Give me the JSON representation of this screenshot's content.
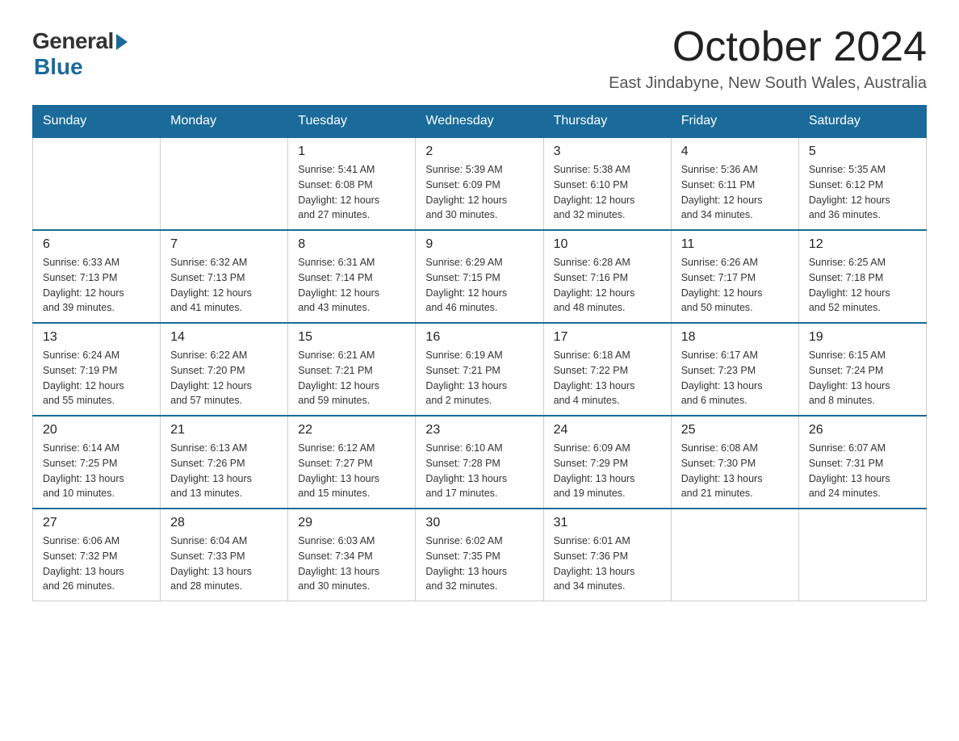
{
  "logo": {
    "general": "General",
    "blue": "Blue"
  },
  "title": "October 2024",
  "location": "East Jindabyne, New South Wales, Australia",
  "headers": [
    "Sunday",
    "Monday",
    "Tuesday",
    "Wednesday",
    "Thursday",
    "Friday",
    "Saturday"
  ],
  "weeks": [
    [
      {
        "day": "",
        "info": ""
      },
      {
        "day": "",
        "info": ""
      },
      {
        "day": "1",
        "info": "Sunrise: 5:41 AM\nSunset: 6:08 PM\nDaylight: 12 hours\nand 27 minutes."
      },
      {
        "day": "2",
        "info": "Sunrise: 5:39 AM\nSunset: 6:09 PM\nDaylight: 12 hours\nand 30 minutes."
      },
      {
        "day": "3",
        "info": "Sunrise: 5:38 AM\nSunset: 6:10 PM\nDaylight: 12 hours\nand 32 minutes."
      },
      {
        "day": "4",
        "info": "Sunrise: 5:36 AM\nSunset: 6:11 PM\nDaylight: 12 hours\nand 34 minutes."
      },
      {
        "day": "5",
        "info": "Sunrise: 5:35 AM\nSunset: 6:12 PM\nDaylight: 12 hours\nand 36 minutes."
      }
    ],
    [
      {
        "day": "6",
        "info": "Sunrise: 6:33 AM\nSunset: 7:13 PM\nDaylight: 12 hours\nand 39 minutes."
      },
      {
        "day": "7",
        "info": "Sunrise: 6:32 AM\nSunset: 7:13 PM\nDaylight: 12 hours\nand 41 minutes."
      },
      {
        "day": "8",
        "info": "Sunrise: 6:31 AM\nSunset: 7:14 PM\nDaylight: 12 hours\nand 43 minutes."
      },
      {
        "day": "9",
        "info": "Sunrise: 6:29 AM\nSunset: 7:15 PM\nDaylight: 12 hours\nand 46 minutes."
      },
      {
        "day": "10",
        "info": "Sunrise: 6:28 AM\nSunset: 7:16 PM\nDaylight: 12 hours\nand 48 minutes."
      },
      {
        "day": "11",
        "info": "Sunrise: 6:26 AM\nSunset: 7:17 PM\nDaylight: 12 hours\nand 50 minutes."
      },
      {
        "day": "12",
        "info": "Sunrise: 6:25 AM\nSunset: 7:18 PM\nDaylight: 12 hours\nand 52 minutes."
      }
    ],
    [
      {
        "day": "13",
        "info": "Sunrise: 6:24 AM\nSunset: 7:19 PM\nDaylight: 12 hours\nand 55 minutes."
      },
      {
        "day": "14",
        "info": "Sunrise: 6:22 AM\nSunset: 7:20 PM\nDaylight: 12 hours\nand 57 minutes."
      },
      {
        "day": "15",
        "info": "Sunrise: 6:21 AM\nSunset: 7:21 PM\nDaylight: 12 hours\nand 59 minutes."
      },
      {
        "day": "16",
        "info": "Sunrise: 6:19 AM\nSunset: 7:21 PM\nDaylight: 13 hours\nand 2 minutes."
      },
      {
        "day": "17",
        "info": "Sunrise: 6:18 AM\nSunset: 7:22 PM\nDaylight: 13 hours\nand 4 minutes."
      },
      {
        "day": "18",
        "info": "Sunrise: 6:17 AM\nSunset: 7:23 PM\nDaylight: 13 hours\nand 6 minutes."
      },
      {
        "day": "19",
        "info": "Sunrise: 6:15 AM\nSunset: 7:24 PM\nDaylight: 13 hours\nand 8 minutes."
      }
    ],
    [
      {
        "day": "20",
        "info": "Sunrise: 6:14 AM\nSunset: 7:25 PM\nDaylight: 13 hours\nand 10 minutes."
      },
      {
        "day": "21",
        "info": "Sunrise: 6:13 AM\nSunset: 7:26 PM\nDaylight: 13 hours\nand 13 minutes."
      },
      {
        "day": "22",
        "info": "Sunrise: 6:12 AM\nSunset: 7:27 PM\nDaylight: 13 hours\nand 15 minutes."
      },
      {
        "day": "23",
        "info": "Sunrise: 6:10 AM\nSunset: 7:28 PM\nDaylight: 13 hours\nand 17 minutes."
      },
      {
        "day": "24",
        "info": "Sunrise: 6:09 AM\nSunset: 7:29 PM\nDaylight: 13 hours\nand 19 minutes."
      },
      {
        "day": "25",
        "info": "Sunrise: 6:08 AM\nSunset: 7:30 PM\nDaylight: 13 hours\nand 21 minutes."
      },
      {
        "day": "26",
        "info": "Sunrise: 6:07 AM\nSunset: 7:31 PM\nDaylight: 13 hours\nand 24 minutes."
      }
    ],
    [
      {
        "day": "27",
        "info": "Sunrise: 6:06 AM\nSunset: 7:32 PM\nDaylight: 13 hours\nand 26 minutes."
      },
      {
        "day": "28",
        "info": "Sunrise: 6:04 AM\nSunset: 7:33 PM\nDaylight: 13 hours\nand 28 minutes."
      },
      {
        "day": "29",
        "info": "Sunrise: 6:03 AM\nSunset: 7:34 PM\nDaylight: 13 hours\nand 30 minutes."
      },
      {
        "day": "30",
        "info": "Sunrise: 6:02 AM\nSunset: 7:35 PM\nDaylight: 13 hours\nand 32 minutes."
      },
      {
        "day": "31",
        "info": "Sunrise: 6:01 AM\nSunset: 7:36 PM\nDaylight: 13 hours\nand 34 minutes."
      },
      {
        "day": "",
        "info": ""
      },
      {
        "day": "",
        "info": ""
      }
    ]
  ]
}
